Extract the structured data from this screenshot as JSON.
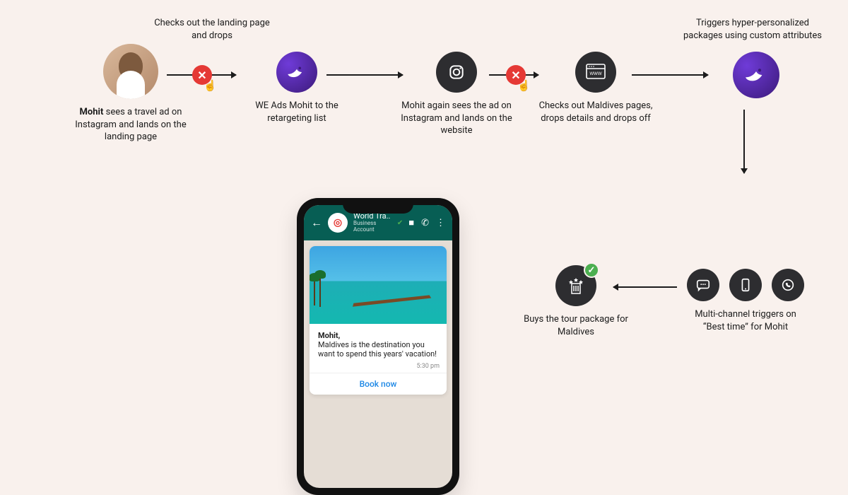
{
  "nodes": {
    "n1_strong": "Mohit",
    "n1_rest": " sees a travel ad on Instagram and lands on the landing page",
    "a1_label": "Checks out the landing page and drops",
    "n2": "WE Ads Mohit to the retargeting list",
    "n3": "Mohit again sees the ad on Instagram and lands on the website",
    "n4": "Checks out Maldives pages, drops details and drops off",
    "n5": "Triggers hyper-personalized packages using custom attributes",
    "n6": "Multi-channel triggers on “Best time” for Mohit",
    "n7": "Buys the tour package for Maldives"
  },
  "phone": {
    "chat_name": "World Tra..",
    "chat_sub": "Business Account",
    "msg_name": "Mohit,",
    "msg_body": "Maldives is the destination you want to spend this years' vacation!",
    "msg_time": "5:30 pm",
    "cta": "Book now"
  },
  "icons": {
    "avatar": "user-avatar",
    "bird": "webengage-bird",
    "instagram": "instagram",
    "browser": "browser-www",
    "chat": "chat-bubble",
    "mobile": "mobile-device",
    "whatsapp": "whatsapp",
    "hotel": "hotel-stars",
    "close": "close-x",
    "check": "checkmark",
    "pointer": "pointer-hand"
  }
}
